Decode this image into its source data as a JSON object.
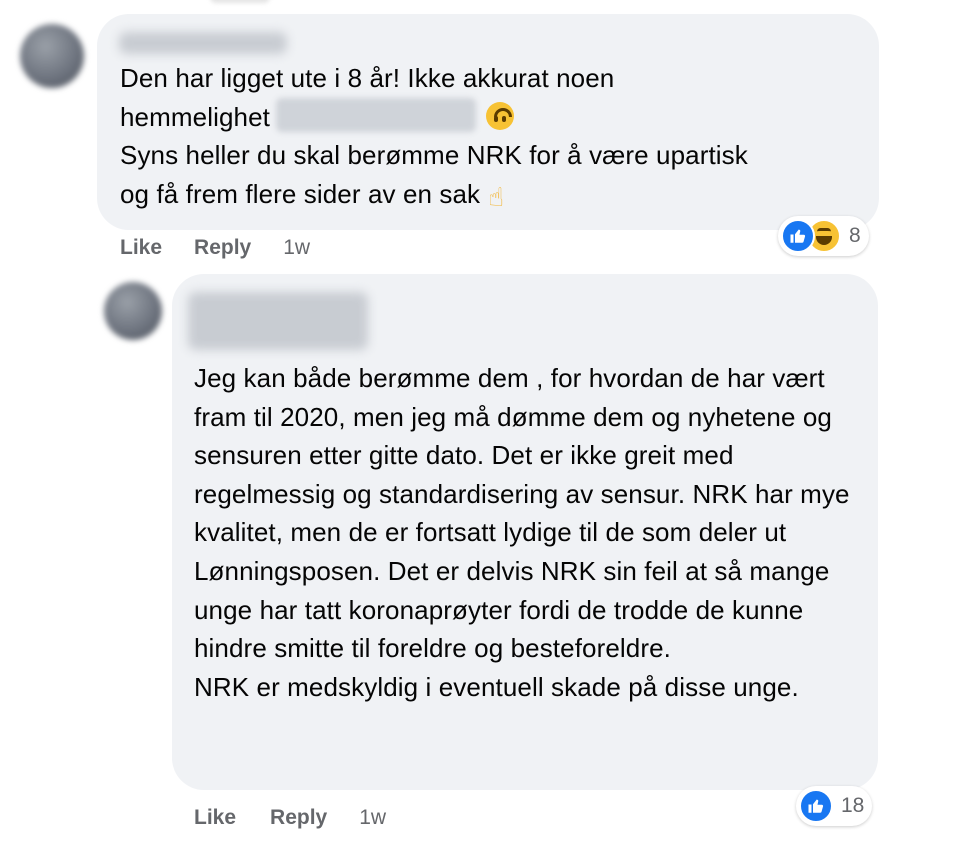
{
  "comments": [
    {
      "author": "",
      "text": {
        "line1": "Den har ligget ute i 8 år! Ikke akkurat noen",
        "line2_prefix": "hemmelighet",
        "line3": "Syns heller du skal berømme NRK for å være upartisk",
        "line4": "og få frem flere sider av en sak"
      },
      "emojis": [
        "upside-down-face-emoji",
        "thumbs-up-emoji"
      ],
      "actions": {
        "like": "Like",
        "reply": "Reply",
        "time": "1w"
      },
      "reactions": {
        "types": [
          "like-icon",
          "haha-icon"
        ],
        "count": "8"
      }
    },
    {
      "author": "",
      "text": {
        "paragraph1": "Jeg kan både berømme dem , for hvordan de har vært fram til 2020, men jeg må dømme dem og nyhetene og sensuren etter gitte dato. Det er ikke greit med regelmessig og standardisering av sensur. NRK har mye kvalitet, men de er fortsatt lydige til de som deler ut Lønningsposen. Det er delvis NRK sin feil at så mange unge har tatt koronaprøyter fordi de trodde de kunne hindre smitte til foreldre og besteforeldre.",
        "paragraph2": "NRK er medskyldig i eventuell skade på disse unge."
      },
      "actions": {
        "like": "Like",
        "reply": "Reply",
        "time": "1w"
      },
      "reactions": {
        "types": [
          "like-icon"
        ],
        "count": "18"
      }
    }
  ],
  "colors": {
    "bubble": "#f0f2f5",
    "text": "#050505",
    "secondary": "#65676b",
    "like_blue": "#1877f2",
    "emoji_yellow": "#f7c234"
  }
}
